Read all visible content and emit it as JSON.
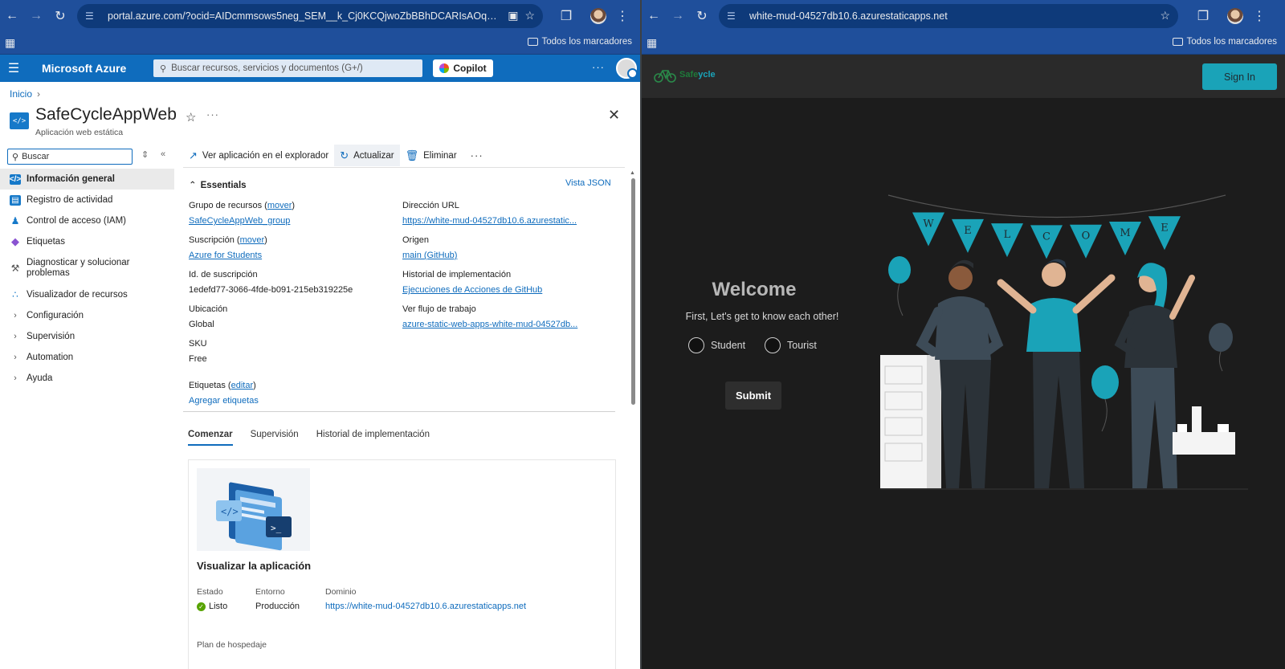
{
  "left_browser": {
    "url": "portal.azure.com/?ocid=AIDcmmsows5neg_SEM__k_Cj0KCQjwoZbBBhDCARIsAOqMEZXIoAFz...",
    "bookmarks_label": "Todos los marcadores"
  },
  "right_browser": {
    "url": "white-mud-04527db10.6.azurestaticapps.net",
    "bookmarks_label": "Todos los marcadores"
  },
  "azure": {
    "brand": "Microsoft Azure",
    "search_placeholder": "Buscar recursos, servicios y documentos (G+/)",
    "copilot_label": "Copilot",
    "breadcrumb": "Inicio",
    "resource_title": "SafeCycleAppWeb",
    "resource_subtitle": "Aplicación web estática",
    "side_search_placeholder": "Buscar",
    "sidebar": {
      "items": [
        {
          "label": "Información general",
          "icon": "overview-icon",
          "color": "#1679c9"
        },
        {
          "label": "Registro de actividad",
          "icon": "activity-log-icon",
          "color": "#1679c9"
        },
        {
          "label": "Control de acceso (IAM)",
          "icon": "iam-icon",
          "color": "#1679c9"
        },
        {
          "label": "Etiquetas",
          "icon": "tag-icon",
          "color": "#8a53d1"
        },
        {
          "label": "Diagnosticar y solucionar problemas",
          "icon": "wrench-icon",
          "color": "#555555"
        },
        {
          "label": "Visualizador de recursos",
          "icon": "resource-visualizer-icon",
          "color": "#1679c9"
        },
        {
          "label": "Configuración"
        },
        {
          "label": "Supervisión"
        },
        {
          "label": "Automation"
        },
        {
          "label": "Ayuda"
        }
      ]
    },
    "commands": {
      "browse": "Ver aplicación en el explorador",
      "refresh": "Actualizar",
      "delete": "Eliminar"
    },
    "essentials": {
      "title": "Essentials",
      "json_view": "Vista JSON",
      "left": [
        {
          "label": "Grupo de recursos",
          "action": "mover",
          "value": "SafeCycleAppWeb_group",
          "link": true
        },
        {
          "label": "Suscripción",
          "action": "mover",
          "value": "Azure for Students",
          "link": true
        },
        {
          "label": "Id. de suscripción",
          "value": "1edefd77-3066-4fde-b091-215eb319225e",
          "link": false
        },
        {
          "label": "Ubicación",
          "value": "Global",
          "link": false
        },
        {
          "label": "SKU",
          "value": "Free",
          "link": false
        }
      ],
      "right": [
        {
          "label": "Dirección URL",
          "value": "https://white-mud-04527db10.6.azurestatic...",
          "link": true
        },
        {
          "label": "Origen",
          "value": "main (GitHub)",
          "link": true
        },
        {
          "label": "Historial de implementación",
          "value": "Ejecuciones de Acciones de GitHub",
          "link": true
        },
        {
          "label": "Ver flujo de trabajo",
          "value": "azure-static-web-apps-white-mud-04527db...",
          "link": true
        }
      ],
      "tags_label": "Etiquetas",
      "tags_action": "editar",
      "add_tags": "Agregar etiquetas"
    },
    "tabs": [
      "Comenzar",
      "Supervisión",
      "Historial de implementación"
    ],
    "card": {
      "title": "Visualizar la aplicación",
      "status_label": "Estado",
      "status_value": "Listo",
      "env_label": "Entorno",
      "env_value": "Producción",
      "domain_label": "Dominio",
      "domain_value": "https://white-mud-04527db10.6.azurestaticapps.net",
      "plan_label": "Plan de hospedaje"
    }
  },
  "app": {
    "logo_part1": "Safe",
    "logo_part2": "ycle",
    "sign_in": "Sign In",
    "welcome": "Welcome",
    "subtitle": "First, Let's get to know each other!",
    "options": [
      "Student",
      "Tourist"
    ],
    "submit": "Submit",
    "banner_letters": [
      "W",
      "E",
      "L",
      "C",
      "O",
      "M",
      "E"
    ],
    "accent_color": "#1aa3b8"
  }
}
